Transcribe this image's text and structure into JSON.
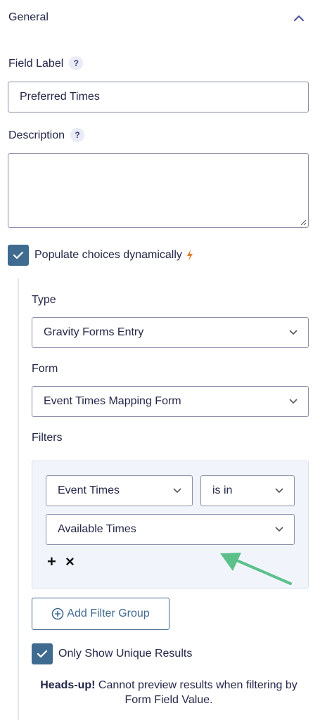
{
  "section": {
    "title": "General"
  },
  "field_label": {
    "label": "Field Label",
    "help": "?",
    "value": "Preferred Times"
  },
  "description": {
    "label": "Description",
    "help": "?",
    "value": ""
  },
  "populate": {
    "label": "Populate choices dynamically",
    "checked": true,
    "accent": "#e07b2e"
  },
  "type": {
    "label": "Type",
    "value": "Gravity Forms Entry"
  },
  "form": {
    "label": "Form",
    "value": "Event Times Mapping Form"
  },
  "filters": {
    "label": "Filters",
    "field_value": "Event Times",
    "operator_value": "is in",
    "value_value": "Available Times",
    "add_symbol": "+",
    "remove_symbol": "×"
  },
  "add_filter_group": {
    "label": "Add Filter Group"
  },
  "unique": {
    "label": "Only Show Unique Results",
    "checked": true
  },
  "notice": {
    "bold": "Heads-up!",
    "text": " Cannot preview results when filtering by Form Field Value."
  },
  "colors": {
    "primary": "#3f6b90",
    "arrow": "#5cc08b"
  }
}
